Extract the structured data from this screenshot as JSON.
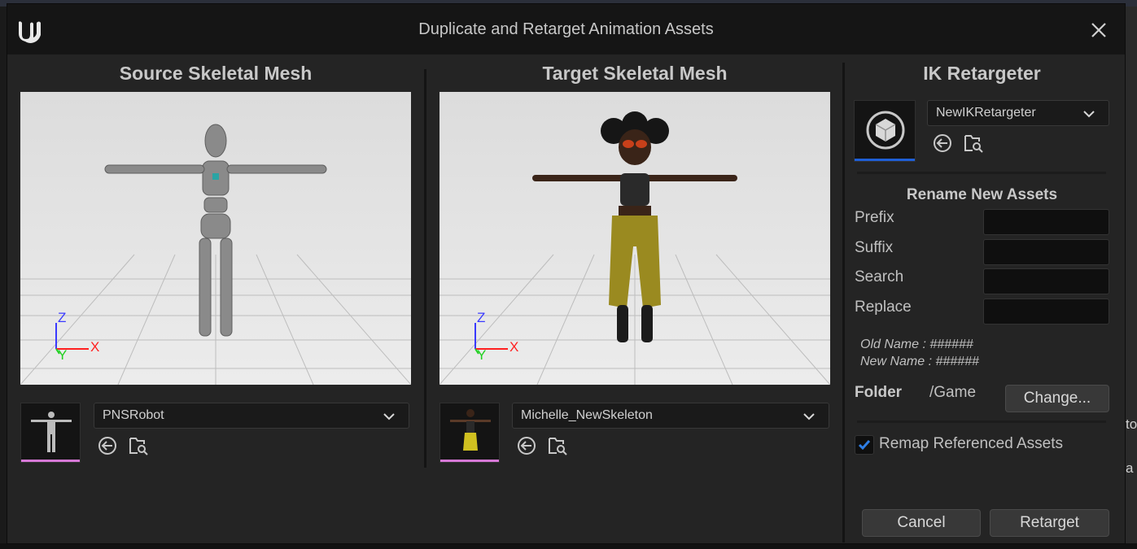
{
  "window": {
    "title": "Duplicate and Retarget Animation Assets"
  },
  "source": {
    "heading": "Source Skeletal Mesh",
    "selected": "PNSRobot",
    "axes": {
      "z": "Z",
      "x": "X",
      "y": "Y"
    }
  },
  "target": {
    "heading": "Target Skeletal Mesh",
    "selected": "Michelle_NewSkeleton",
    "axes": {
      "z": "Z",
      "x": "X",
      "y": "Y"
    }
  },
  "retargeter": {
    "heading": "IK Retargeter",
    "selected": "NewIKRetargeter"
  },
  "rename": {
    "heading": "Rename New Assets",
    "prefix_label": "Prefix",
    "suffix_label": "Suffix",
    "search_label": "Search",
    "replace_label": "Replace",
    "prefix_value": "",
    "suffix_value": "",
    "search_value": "",
    "replace_value": "",
    "old_name": "Old Name : ######",
    "new_name": "New Name : ######"
  },
  "folder": {
    "label": "Folder",
    "path": "/Game",
    "change_button": "Change..."
  },
  "remap": {
    "label": "Remap Referenced Assets",
    "checked": true
  },
  "buttons": {
    "cancel": "Cancel",
    "retarget": "Retarget"
  },
  "desktop": {
    "fragment_top": "to",
    "fragment_bottom": "a"
  },
  "colors": {
    "axis_z": "#3a3aff",
    "axis_x": "#ff2020",
    "axis_y": "#20d020",
    "check_accent": "#2e7ee6",
    "thumb_skeletal": "#d678d6",
    "thumb_retargeter": "#1f5fd6"
  },
  "icons": [
    "unreal-logo-icon",
    "close-icon",
    "chevron-down-icon",
    "use-selected-icon",
    "browse-icon",
    "ik-retargeter-asset-icon",
    "checkmark-icon"
  ]
}
